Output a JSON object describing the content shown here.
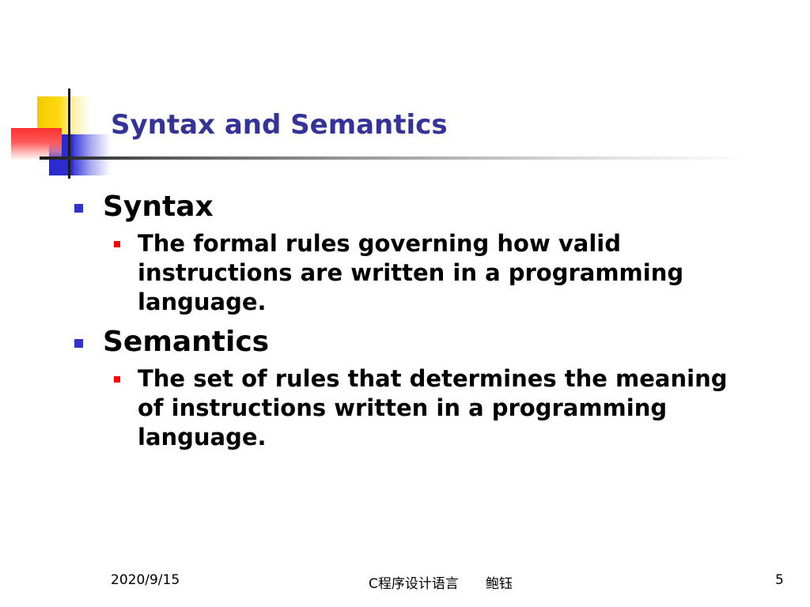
{
  "slide": {
    "title": "Syntax and Semantics",
    "items": [
      {
        "heading": "Syntax",
        "detail": "The formal rules governing how valid instructions are written in a programming language."
      },
      {
        "heading": "Semantics",
        "detail": "The set of rules that determines the meaning of instructions written in a programming language."
      }
    ]
  },
  "footer": {
    "date": "2020/9/15",
    "center": "C程序设计语言　　鲍钰",
    "page_number": "5"
  },
  "colors": {
    "title": "#333399",
    "level1_bullet": "#3333cc",
    "level2_bullet": "#ff0000",
    "deco_yellow": "#ffd90f",
    "deco_blue": "#2b2bd0",
    "deco_red": "#ff3030"
  }
}
